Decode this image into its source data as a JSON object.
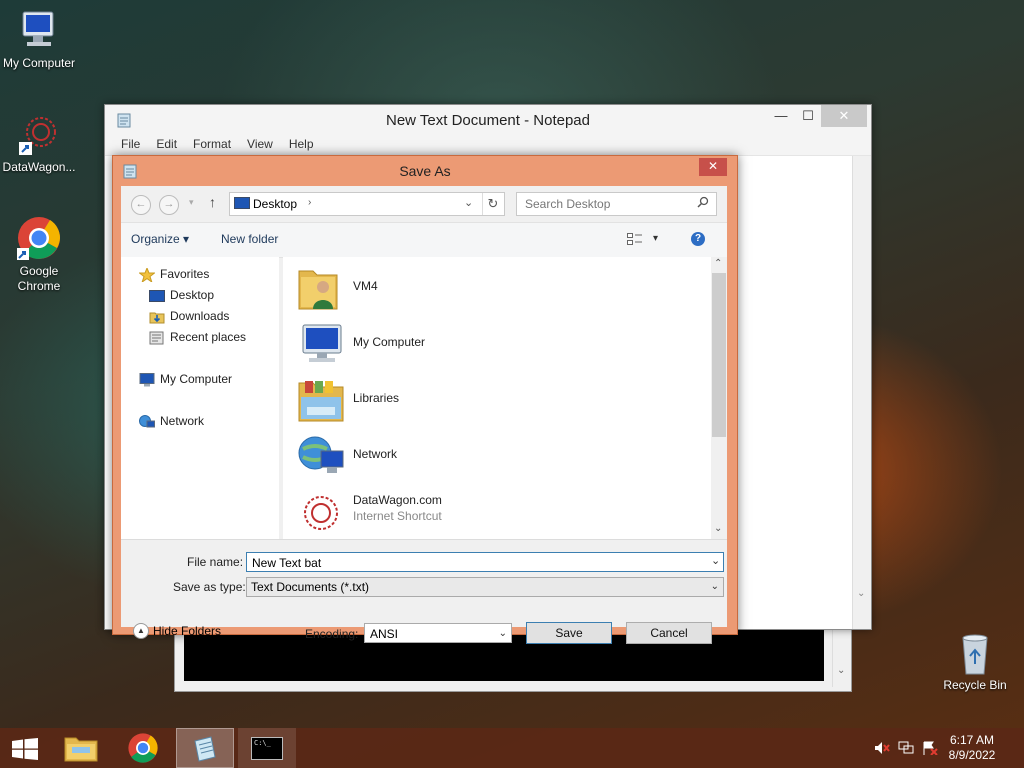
{
  "desktop": {
    "icons": [
      {
        "label": "My Computer"
      },
      {
        "label": "DataWagon..."
      },
      {
        "label": "Google Chrome"
      },
      {
        "label": "Recycle Bin"
      }
    ]
  },
  "notepad": {
    "title": "New Text Document - Notepad",
    "menu": [
      "File",
      "Edit",
      "Format",
      "View",
      "Help"
    ]
  },
  "dialog": {
    "title": "Save As",
    "close_label": "✕",
    "address": {
      "location": "Desktop",
      "search_placeholder": "Search Desktop"
    },
    "toolbar": {
      "organize": "Organize ▾",
      "new_folder": "New folder"
    },
    "nav": {
      "favorites": "Favorites",
      "favorites_items": [
        "Desktop",
        "Downloads",
        "Recent places"
      ],
      "my_computer": "My Computer",
      "network": "Network"
    },
    "files": [
      {
        "name": "VM4",
        "icon": "user-folder-icon"
      },
      {
        "name": "My Computer",
        "icon": "computer-icon"
      },
      {
        "name": "Libraries",
        "icon": "libraries-icon"
      },
      {
        "name": "Network",
        "icon": "network-icon"
      },
      {
        "name": "DataWagon.com",
        "sub": "Internet Shortcut",
        "icon": "datawagon-icon"
      }
    ],
    "file_name_label": "File name:",
    "file_name_value": "New Text bat",
    "save_type_label": "Save as type:",
    "save_type_value": "Text Documents (*.txt)",
    "hide_folders": "Hide Folders",
    "encoding_label": "Encoding:",
    "encoding_value": "ANSI",
    "save_button": "Save",
    "cancel_button": "Cancel"
  },
  "taskbar": {
    "time": "6:17 AM",
    "date": "8/9/2022",
    "cmd_label": "C:\\_"
  }
}
